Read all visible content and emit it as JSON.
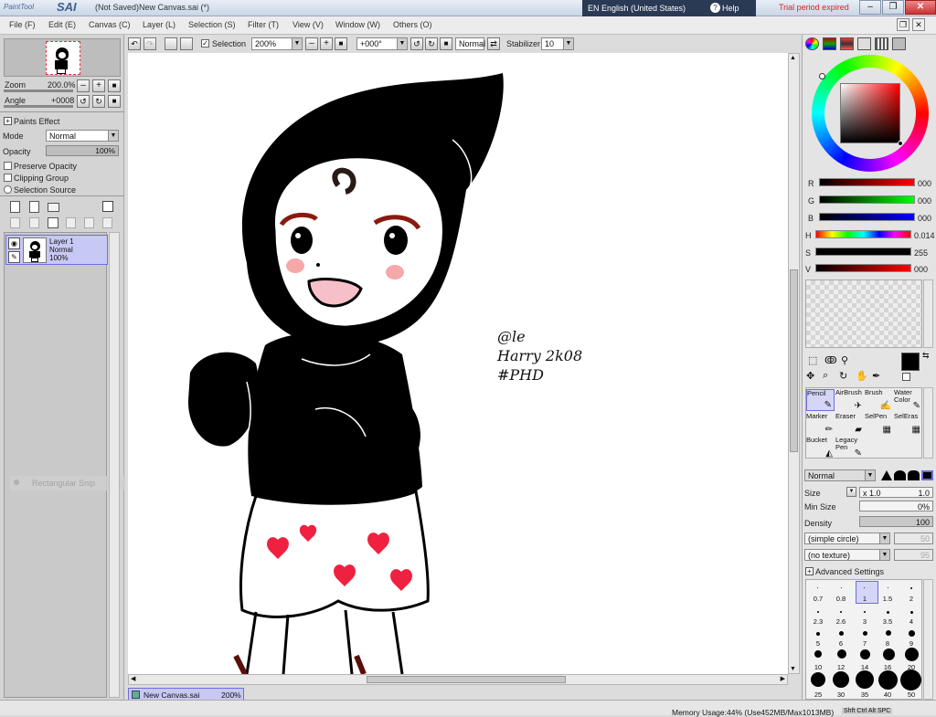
{
  "title": {
    "logo_small": "PaintTool",
    "logo_big": "SAI",
    "doc": "(Not Saved)New Canvas.sai (*)",
    "language": "EN English (United States)",
    "help": "Help",
    "trial": "Trial period expired"
  },
  "menu": [
    "File (F)",
    "Edit (E)",
    "Canvas (C)",
    "Layer (L)",
    "Selection (S)",
    "Filter (T)",
    "View (V)",
    "Window (W)",
    "Others (O)"
  ],
  "navigator": {
    "zoom_label": "Zoom",
    "zoom_value": "200.0%",
    "angle_label": "Angle",
    "angle_value": "+0008"
  },
  "layer_panel": {
    "paints_effect": "Paints Effect",
    "mode_label": "Mode",
    "mode_value": "Normal",
    "opacity_label": "Opacity",
    "opacity_value": "100%",
    "preserve_opacity": "Preserve Opacity",
    "clipping_group": "Clipping Group",
    "selection_source": "Selection Source",
    "layer_name": "Layer 1",
    "layer_mode": "Normal",
    "layer_opacity": "100%",
    "snip_tooltip": "Rectangular Snip"
  },
  "toolbar": {
    "selection": "Selection",
    "zoom": "200%",
    "angle": "+000°",
    "blend": "Normal",
    "stabilizer_label": "Stabilizer",
    "stabilizer_value": "10"
  },
  "canvas_text": {
    "line1": "@le",
    "line2": "Harry 2k08",
    "line3": "#PHD"
  },
  "color": {
    "r_label": "R",
    "r_value": "000",
    "g_label": "G",
    "g_value": "000",
    "b_label": "B",
    "b_value": "000",
    "h_label": "H",
    "h_value": "0.014",
    "s_label": "S",
    "s_value": "255",
    "v_label": "V",
    "v_value": "000",
    "primary": "#000000"
  },
  "tools": [
    {
      "label": "Pencil"
    },
    {
      "label": "AirBrush"
    },
    {
      "label": "Brush"
    },
    {
      "label": "Water Color"
    },
    {
      "label": "Marker"
    },
    {
      "label": "Eraser"
    },
    {
      "label": "SelPen"
    },
    {
      "label": "SelEras"
    },
    {
      "label": "Bucket"
    },
    {
      "label": "Legacy Pen"
    }
  ],
  "brush": {
    "mode": "Normal",
    "size_label": "Size",
    "size_mult": "x 1.0",
    "size_value": "1.0",
    "min_size_label": "Min Size",
    "min_size_value": "0%",
    "density_label": "Density",
    "density_value": "100",
    "shape": "(simple circle)",
    "shape_value": "50",
    "texture": "(no texture)",
    "texture_value": "95",
    "advanced": "Advanced Settings"
  },
  "brush_sizes": [
    "0.7",
    "0.8",
    "1",
    "1.5",
    "2",
    "2.3",
    "2.6",
    "3",
    "3.5",
    "4",
    "5",
    "6",
    "7",
    "8",
    "9",
    "10",
    "12",
    "14",
    "16",
    "20",
    "25",
    "30",
    "35",
    "40",
    "50"
  ],
  "doc_tab": {
    "name": "New Canvas.sai",
    "zoom": "200%"
  },
  "status": {
    "memory": "Memory Usage:44% (Use452MB/Max1013MB)",
    "keys": "Shft Ctrl Alt SPC"
  }
}
